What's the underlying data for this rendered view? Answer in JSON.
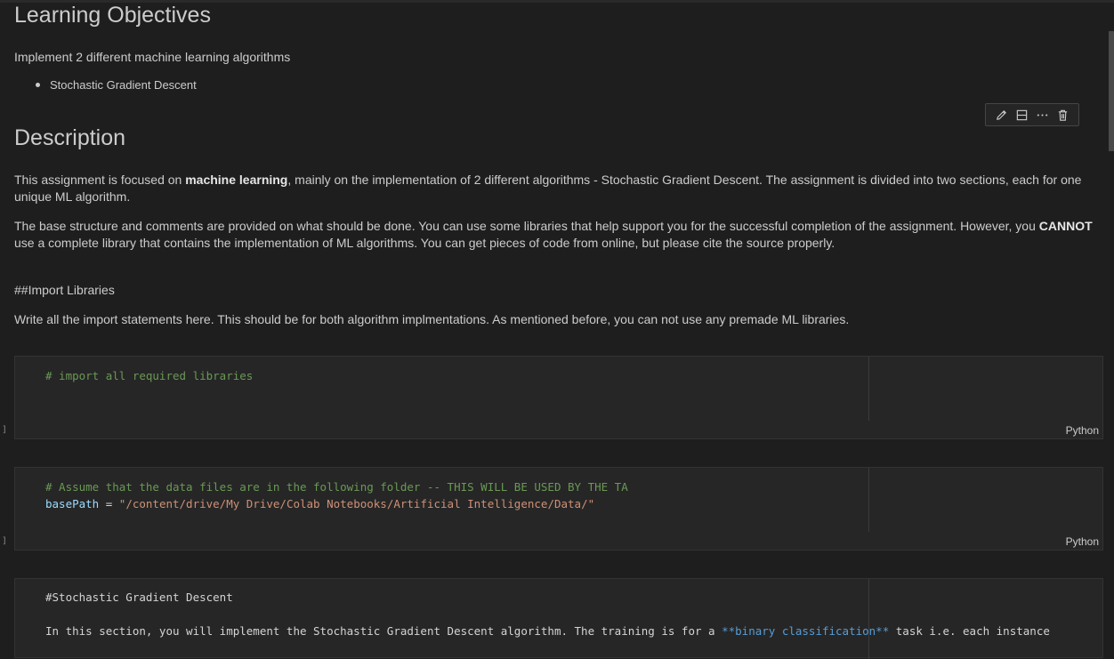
{
  "headings": {
    "objectives": "Learning Objectives",
    "description": "Description"
  },
  "objectives": {
    "intro": "Implement 2 different machine learning algorithms",
    "bullets": [
      "Stochastic Gradient Descent"
    ]
  },
  "description": {
    "p1_a": "This assignment is focused on ",
    "p1_b": "machine learning",
    "p1_c": ", mainly on the implementation of 2 different algorithms - Stochastic Gradient Descent. The assignment is divided into two sections, each for one unique ML algorithm.",
    "p2_a": "The base structure and comments are provided on what should be done. You can use some libraries that help support you for the successful completion of the assignment. However, you ",
    "p2_b": "CANNOT",
    "p2_c": " use a complete library that contains the implementation of ML algorithms. You can get pieces of code from online, but please cite the source properly."
  },
  "import_section": {
    "heading": "##Import Libraries",
    "text": "Write all the import statements here. This should be for both algorithm implmentations. As mentioned before, you can not use any premade ML libraries."
  },
  "cells": [
    {
      "comment": "# import all required libraries",
      "language": "Python",
      "bracket": "]"
    },
    {
      "comment": "# Assume that the data files are in the following folder -- THIS WILL BE USED BY THE TA",
      "var": "basePath",
      "op": " = ",
      "str": "\"/content/drive/My Drive/Colab Notebooks/Artificial Intelligence/Data/\"",
      "language": "Python",
      "bracket": "]"
    },
    {
      "line1": "#Stochastic Gradient Descent",
      "line3_a": "In this section, you will implement the Stochastic Gradient Descent algorithm. The training is for a ",
      "line3_b": "**binary classification**",
      "line3_c": " task i.e. each instance"
    }
  ],
  "toolbar": {
    "icons": [
      "pencil-icon",
      "split-cell-icon",
      "more-icon",
      "trash-icon"
    ]
  },
  "colors": {
    "background": "#1e1e1e",
    "cell_background": "#262626",
    "comment": "#6a9955",
    "variable": "#9cdcfe",
    "string": "#ce9178",
    "markdown_bold": "#569cd6"
  }
}
